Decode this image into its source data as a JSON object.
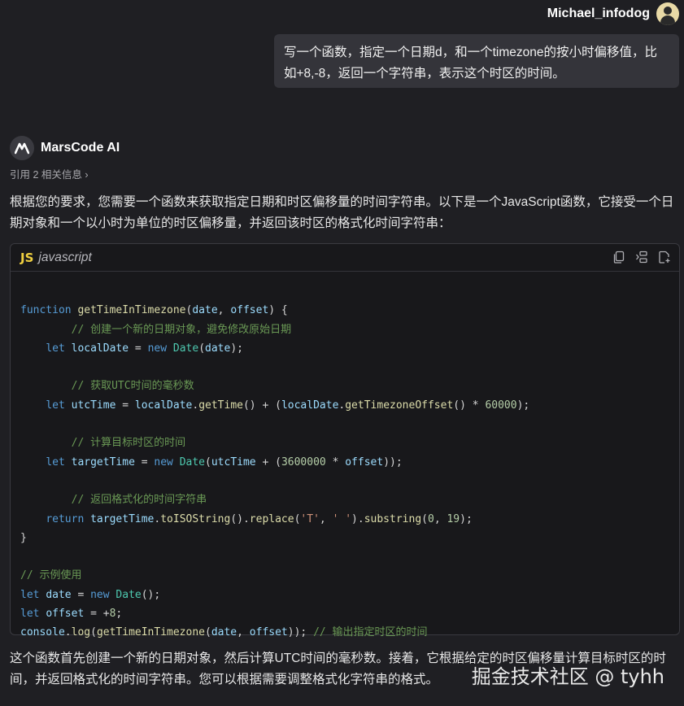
{
  "user": {
    "name": "Michael_infodog",
    "message": "写一个函数，指定一个日期d，和一个timezone的按小时偏移值，比如+8,-8，返回一个字符串，表示这个时区的时间。"
  },
  "ai": {
    "name": "MarsCode AI",
    "refs_label": "引用 2 相关信息",
    "refs_chevron": "›",
    "intro": "根据您的要求，您需要一个函数来获取指定日期和时区偏移量的时间字符串。以下是一个JavaScript函数，它接受一个日期对象和一个以小时为单位的时区偏移量，并返回该时区的格式化时间字符串：",
    "outro": "这个函数首先创建一个新的日期对象，然后计算UTC时间的毫秒数。接着，它根据给定的时区偏移量计算目标时区的时间，并返回格式化的时间字符串。您可以根据需要调整格式化字符串的格式。"
  },
  "code_block": {
    "badge": "JS",
    "language": "javascript",
    "actions": [
      "copy-icon",
      "insert-icon",
      "new-file-icon"
    ],
    "lines": [
      "function getTimeInTimezone(date, offset) {",
      "    // 创建一个新的日期对象，避免修改原始日期",
      "    let localDate = new Date(date);",
      "",
      "    // 获取UTC时间的毫秒数",
      "    let utcTime = localDate.getTime() + (localDate.getTimezoneOffset() * 60000);",
      "",
      "    // 计算目标时区的时间",
      "    let targetTime = new Date(utcTime + (3600000 * offset));",
      "",
      "    // 返回格式化的时间字符串",
      "    return targetTime.toISOString().replace('T', ' ').substring(0, 19);",
      "}",
      "",
      "// 示例使用",
      "let date = new Date();",
      "let offset = +8;",
      "console.log(getTimeInTimezone(date, offset)); // 输出指定时区的时间"
    ]
  },
  "watermark": "掘金技术社区 @ tyhh",
  "colors": {
    "background": "#1f1f23",
    "bubble": "#34343a",
    "code_bg": "#18181b",
    "js_badge": "#f0d040",
    "keyword": "#569cd6",
    "function": "#dcdcaa",
    "comment": "#6a9955",
    "number": "#b5cea8",
    "string": "#ce9178"
  }
}
